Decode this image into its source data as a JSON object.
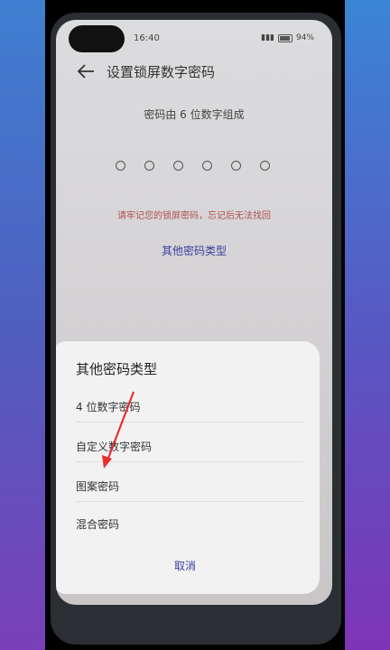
{
  "status": {
    "time": "16:40",
    "battery": "94%"
  },
  "header": {
    "title": "设置锁屏数字密码"
  },
  "pin": {
    "hint": "密码由 6 位数字组成",
    "digits": 6
  },
  "warning": "请牢记您的锁屏密码，忘记后无法找回",
  "other_types_link": "其他密码类型",
  "sheet": {
    "title": "其他密码类型",
    "options": [
      "4 位数字密码",
      "自定义数字密码",
      "图案密码",
      "混合密码"
    ],
    "cancel": "取消"
  },
  "colors": {
    "accent": "#3a3ea0",
    "warning": "#b25050",
    "arrow": "#e53030"
  }
}
